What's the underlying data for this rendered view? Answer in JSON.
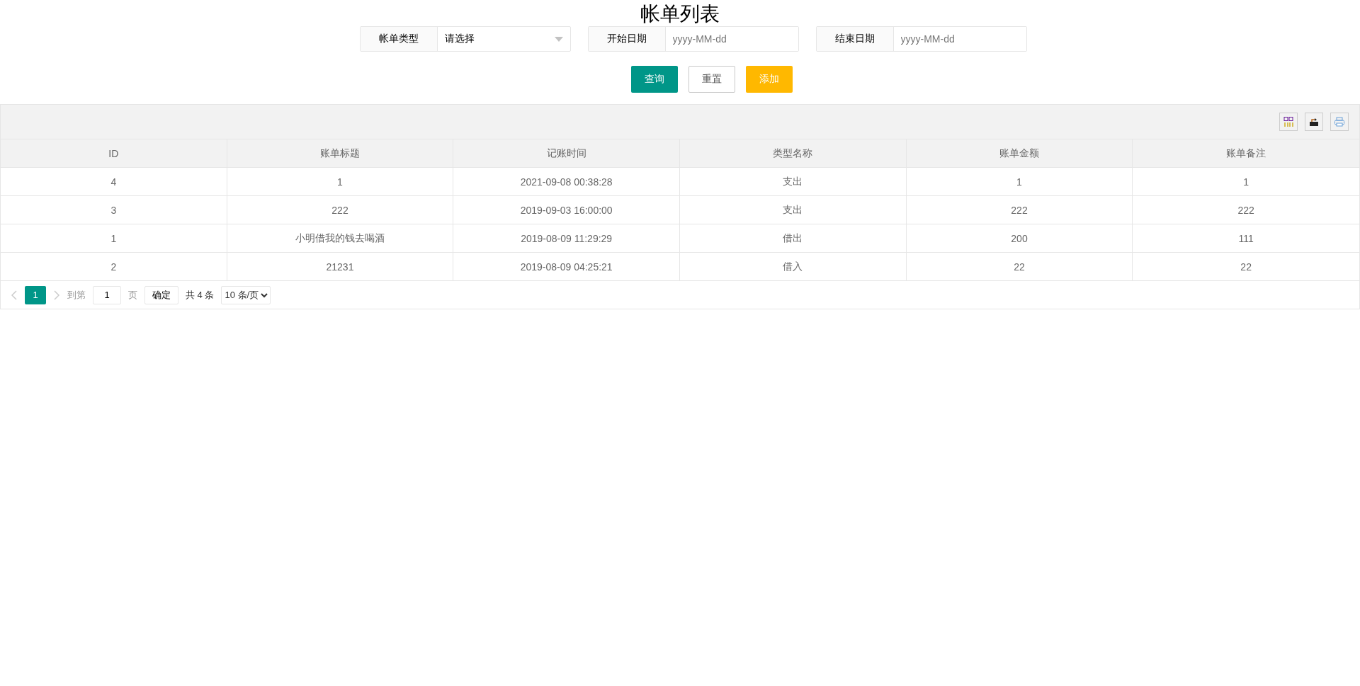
{
  "title": "帐单列表",
  "filters": [
    {
      "label": "帐单类型",
      "kind": "select",
      "value": "请选择"
    },
    {
      "label": "开始日期",
      "kind": "date",
      "placeholder": "yyyy-MM-dd"
    },
    {
      "label": "结束日期",
      "kind": "date",
      "placeholder": "yyyy-MM-dd"
    }
  ],
  "buttons": [
    {
      "label": "查询",
      "kind": "primary"
    },
    {
      "label": "重置",
      "kind": "plain"
    },
    {
      "label": "添加",
      "kind": "warm"
    }
  ],
  "table": {
    "columns": [
      "ID",
      "账单标题",
      "记账时间",
      "类型名称",
      "账单金额",
      "账单备注"
    ],
    "rows": [
      [
        "4",
        "1",
        "2021-09-08 00:38:28",
        "支出",
        "1",
        "1"
      ],
      [
        "3",
        "222",
        "2019-09-03 16:00:00",
        "支出",
        "222",
        "222"
      ],
      [
        "1",
        "小明借我的钱去喝酒",
        "2019-08-09 11:29:29",
        "借出",
        "200",
        "111"
      ],
      [
        "2",
        "21231",
        "2019-08-09 04:25:21",
        "借入",
        "22",
        "22"
      ]
    ]
  },
  "pagination": {
    "pages": [
      {
        "label": "1",
        "selected": true
      }
    ],
    "goto_label": "到第",
    "goto_value": "1",
    "page_unit": "页",
    "confirm": "确定",
    "total": "共 4 条",
    "page_size": "10 条/页"
  }
}
